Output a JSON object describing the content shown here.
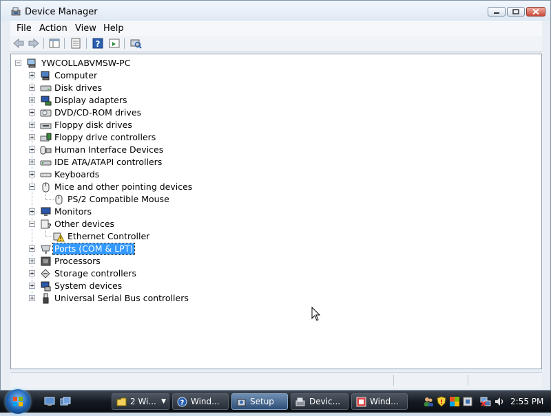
{
  "window": {
    "title": "Device Manager",
    "controls": [
      "minimize",
      "maximize",
      "close"
    ]
  },
  "menu": [
    "File",
    "Action",
    "View",
    "Help"
  ],
  "toolbar": {
    "icons": [
      "back-icon",
      "forward-icon",
      "show-hide-tree-icon",
      "properties-icon",
      "help-icon",
      "update-driver-icon",
      "scan-hardware-icon"
    ]
  },
  "tree": {
    "root": "YWCOLLABVMSW-PC",
    "items": [
      {
        "label": "Computer",
        "icon": "computer-icon",
        "expanded": false
      },
      {
        "label": "Disk drives",
        "icon": "disk-drive-icon",
        "expanded": false
      },
      {
        "label": "Display adapters",
        "icon": "display-adapter-icon",
        "expanded": false
      },
      {
        "label": "DVD/CD-ROM drives",
        "icon": "dvd-drive-icon",
        "expanded": false
      },
      {
        "label": "Floppy disk drives",
        "icon": "floppy-drive-icon",
        "expanded": false
      },
      {
        "label": "Floppy drive controllers",
        "icon": "floppy-controller-icon",
        "expanded": false
      },
      {
        "label": "Human Interface Devices",
        "icon": "hid-icon",
        "expanded": false
      },
      {
        "label": "IDE ATA/ATAPI controllers",
        "icon": "ide-controller-icon",
        "expanded": false
      },
      {
        "label": "Keyboards",
        "icon": "keyboard-icon",
        "expanded": false
      },
      {
        "label": "Mice and other pointing devices",
        "icon": "mouse-icon",
        "expanded": true,
        "children": [
          {
            "label": "PS/2 Compatible Mouse",
            "icon": "mouse-icon"
          }
        ]
      },
      {
        "label": "Monitors",
        "icon": "monitor-icon",
        "expanded": false
      },
      {
        "label": "Other devices",
        "icon": "unknown-device-icon",
        "expanded": true,
        "children": [
          {
            "label": "Ethernet Controller",
            "icon": "warning-device-icon"
          }
        ]
      },
      {
        "label": "Ports (COM & LPT)",
        "icon": "port-icon",
        "expanded": false,
        "selected": true
      },
      {
        "label": "Processors",
        "icon": "processor-icon",
        "expanded": false
      },
      {
        "label": "Storage controllers",
        "icon": "storage-controller-icon",
        "expanded": false
      },
      {
        "label": "System devices",
        "icon": "system-device-icon",
        "expanded": false
      },
      {
        "label": "Universal Serial Bus controllers",
        "icon": "usb-icon",
        "expanded": false
      }
    ]
  },
  "taskbar": {
    "buttons": [
      {
        "label": "2 Wi...",
        "icon": "folder-icon",
        "has_menu": true,
        "active": false
      },
      {
        "label": "Wind...",
        "icon": "help-icon",
        "active": false
      },
      {
        "label": "Setup",
        "icon": "setup-icon",
        "active": true
      },
      {
        "label": "Devic...",
        "icon": "device-manager-icon",
        "active": false
      },
      {
        "label": "Wind...",
        "icon": "windows-app-icon",
        "active": false
      }
    ],
    "clock": "2:55 PM"
  },
  "colors": {
    "selection": "#3399ff",
    "window_frame": "#e9eef4",
    "taskbar": "#141a21"
  }
}
